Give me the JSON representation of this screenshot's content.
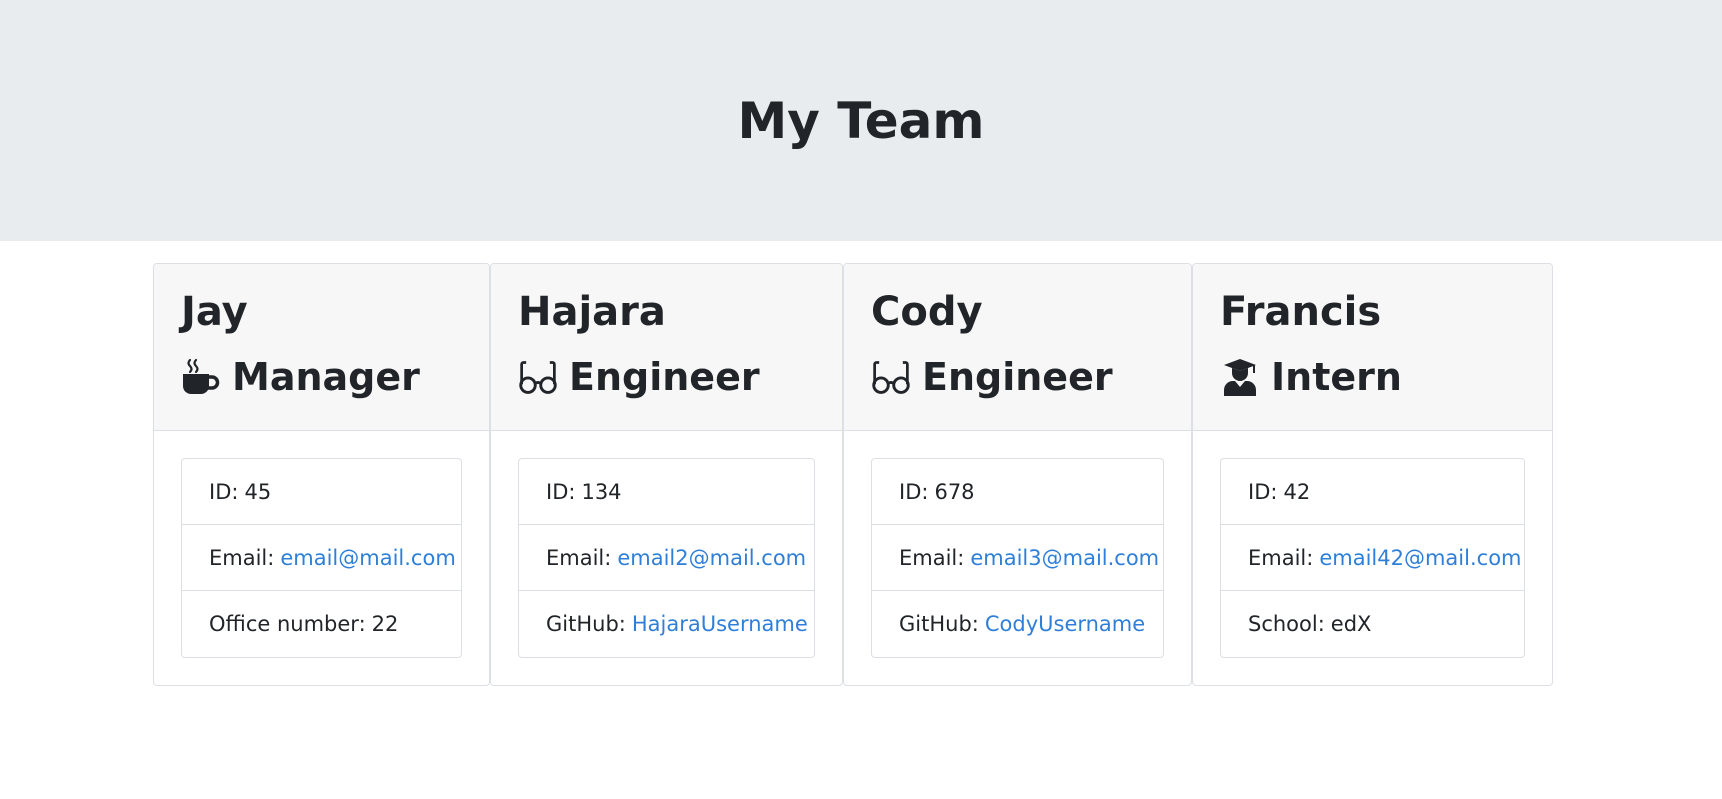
{
  "header": {
    "title": "My Team"
  },
  "team": [
    {
      "name": "Jay",
      "role": "Manager",
      "icon": "coffee-mug-icon",
      "id_label": "ID:",
      "id": "45",
      "email_label": "Email:",
      "email": "email@mail.com",
      "extra_label": "Office number:",
      "extra": "22"
    },
    {
      "name": "Hajara",
      "role": "Engineer",
      "icon": "glasses-icon",
      "id_label": "ID:",
      "id": "134",
      "email_label": "Email:",
      "email": "email2@mail.com",
      "extra_label": "GitHub:",
      "extra": "HajaraUsername"
    },
    {
      "name": "Cody",
      "role": "Engineer",
      "icon": "glasses-icon",
      "id_label": "ID:",
      "id": "678",
      "email_label": "Email:",
      "email": "email3@mail.com",
      "extra_label": "GitHub:",
      "extra": "CodyUsername"
    },
    {
      "name": "Francis",
      "role": "Intern",
      "icon": "graduate-icon",
      "id_label": "ID:",
      "id": "42",
      "email_label": "Email:",
      "email": "email42@mail.com",
      "extra_label": "School:",
      "extra": "edX"
    }
  ],
  "colors": {
    "jumbotron": "#e9ecef",
    "card_header": "#f7f7f7",
    "link": "#2f7fd8",
    "text": "#212529"
  }
}
